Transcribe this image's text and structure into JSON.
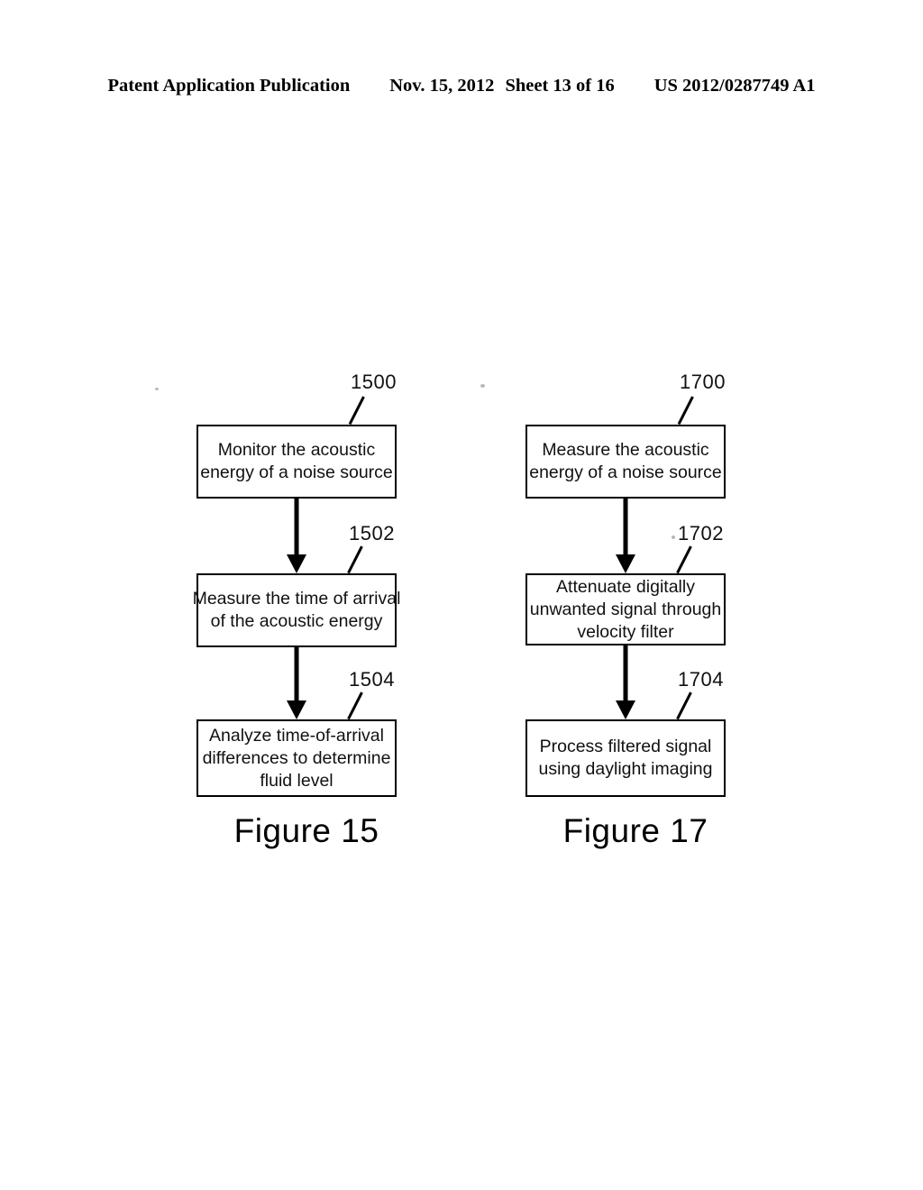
{
  "header": {
    "publication": "Patent Application Publication",
    "date": "Nov. 15, 2012",
    "sheet": "Sheet 13 of 16",
    "patent_number": "US 2012/0287749 A1"
  },
  "figures": [
    {
      "caption": "Figure 15",
      "steps": [
        {
          "ref": "1500",
          "lines": [
            "Monitor the acoustic",
            "energy of a noise source"
          ]
        },
        {
          "ref": "1502",
          "lines": [
            "Measure the time of arrival",
            "of the acoustic energy"
          ]
        },
        {
          "ref": "1504",
          "lines": [
            "Analyze time-of-arrival",
            "differences to determine",
            "fluid level"
          ]
        }
      ]
    },
    {
      "caption": "Figure 17",
      "steps": [
        {
          "ref": "1700",
          "lines": [
            "Measure the acoustic",
            "energy of a noise source"
          ]
        },
        {
          "ref": "1702",
          "lines": [
            "Attenuate digitally",
            "unwanted signal through",
            "velocity filter"
          ]
        },
        {
          "ref": "1704",
          "lines": [
            "Process filtered signal",
            "using daylight imaging"
          ]
        }
      ]
    }
  ]
}
